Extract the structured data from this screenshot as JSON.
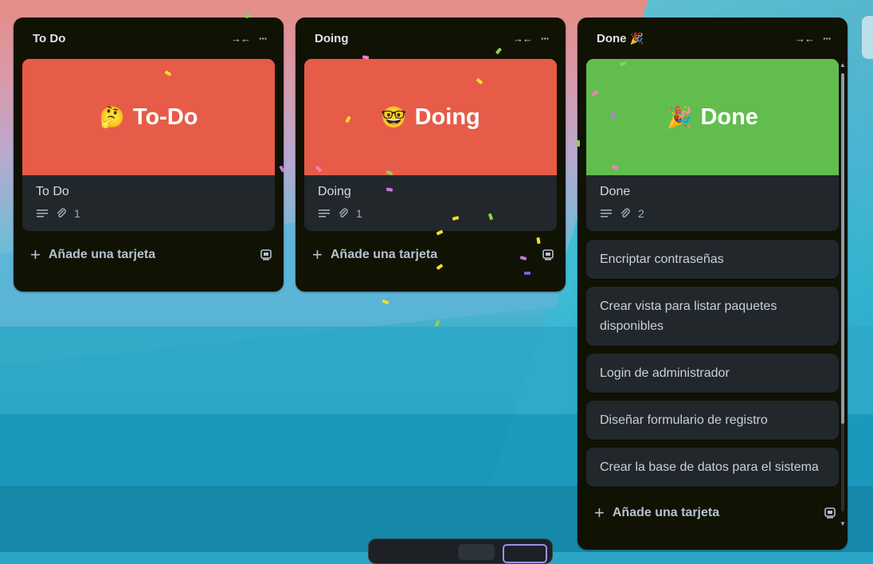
{
  "columns": [
    {
      "title": "To Do",
      "title_emoji": "",
      "cover_card": {
        "cover_emoji": "🤔",
        "cover_text": "To-Do",
        "cover_color": "#e65c48",
        "title": "To Do",
        "attachments": "1"
      },
      "cards": [],
      "add_label": "Añade una tarjeta"
    },
    {
      "title": "Doing",
      "title_emoji": "",
      "cover_card": {
        "cover_emoji": "🤓",
        "cover_text": "Doing",
        "cover_color": "#e65c48",
        "title": "Doing",
        "attachments": "1"
      },
      "cards": [],
      "add_label": "Añade una tarjeta"
    },
    {
      "title": "Done",
      "title_emoji": "🎉",
      "cover_card": {
        "cover_emoji": "🎉",
        "cover_text": "Done",
        "cover_color": "#62bd4f",
        "title": "Done",
        "attachments": "2"
      },
      "cards": [
        "Encriptar contraseñas",
        "Crear vista para listar paquetes disponibles",
        "Login de administrador",
        "Diseñar formulario de registro",
        "Crear la base de datos para el sistema"
      ],
      "add_label": "Añade una tarjeta"
    }
  ],
  "icons": {
    "collapse": "collapse-icon",
    "more": "more-icon",
    "description": "description-icon",
    "attachment": "attachment-icon",
    "template": "template-icon",
    "plus": "plus-icon"
  },
  "colors": {
    "list_bg": "#101204",
    "card_bg": "#22272b",
    "cover_red": "#e65c48",
    "cover_green": "#62bd4f"
  }
}
